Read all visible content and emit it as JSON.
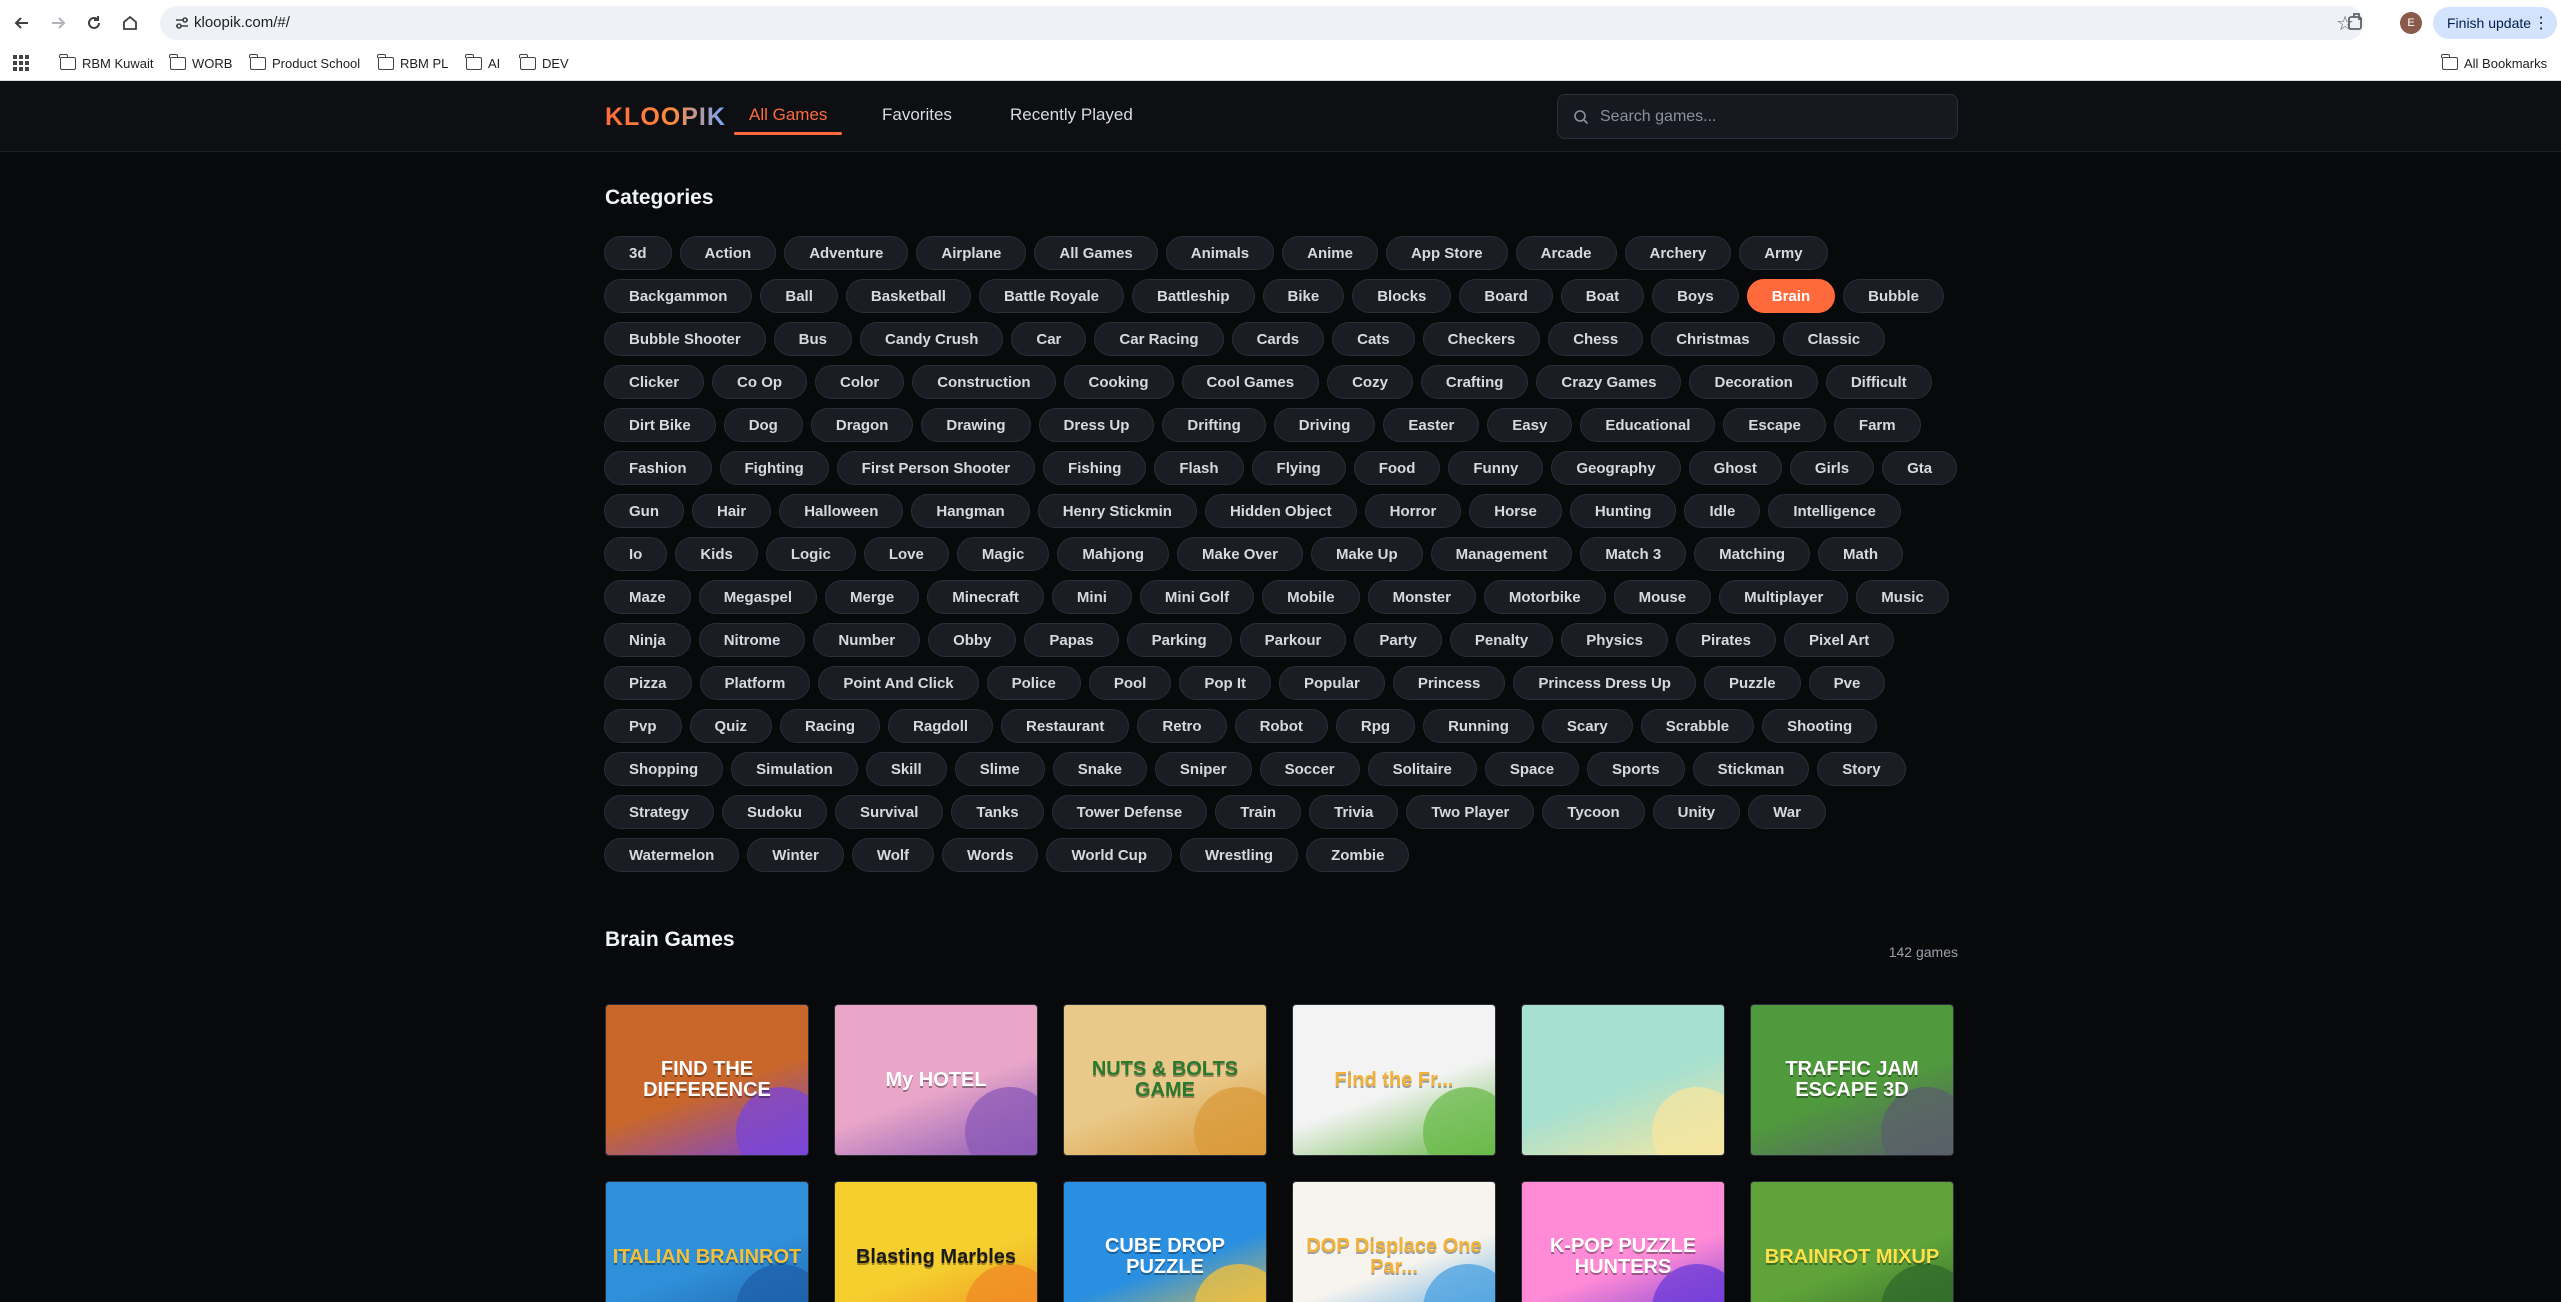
{
  "browser": {
    "url": "kloopik.com/#/",
    "finish_update_label": "Finish update",
    "profile_initial": "E",
    "bookmarks": [
      "RBM Kuwait",
      "WORB",
      "Product School",
      "RBM PL",
      "AI",
      "DEV"
    ],
    "all_bookmarks_label": "All Bookmarks"
  },
  "header": {
    "logo": "KLOOPIK",
    "tabs": [
      "All Games",
      "Favorites",
      "Recently Played"
    ],
    "active_tab": "All Games",
    "search_placeholder": "Search games..."
  },
  "categories": {
    "title": "Categories",
    "active": "Brain",
    "items": [
      "3d",
      "Action",
      "Adventure",
      "Airplane",
      "All Games",
      "Animals",
      "Anime",
      "App Store",
      "Arcade",
      "Archery",
      "Army",
      "Backgammon",
      "Ball",
      "Basketball",
      "Battle Royale",
      "Battleship",
      "Bike",
      "Blocks",
      "Board",
      "Boat",
      "Boys",
      "Brain",
      "Bubble",
      "Bubble Shooter",
      "Bus",
      "Candy Crush",
      "Car",
      "Car Racing",
      "Cards",
      "Cats",
      "Checkers",
      "Chess",
      "Christmas",
      "Classic",
      "Clicker",
      "Co Op",
      "Color",
      "Construction",
      "Cooking",
      "Cool Games",
      "Cozy",
      "Crafting",
      "Crazy Games",
      "Decoration",
      "Difficult",
      "Dirt Bike",
      "Dog",
      "Dragon",
      "Drawing",
      "Dress Up",
      "Drifting",
      "Driving",
      "Easter",
      "Easy",
      "Educational",
      "Escape",
      "Farm",
      "Fashion",
      "Fighting",
      "First Person Shooter",
      "Fishing",
      "Flash",
      "Flying",
      "Food",
      "Funny",
      "Geography",
      "Ghost",
      "Girls",
      "Gta",
      "Gun",
      "Hair",
      "Halloween",
      "Hangman",
      "Henry Stickmin",
      "Hidden Object",
      "Horror",
      "Horse",
      "Hunting",
      "Idle",
      "Intelligence",
      "Io",
      "Kids",
      "Logic",
      "Love",
      "Magic",
      "Mahjong",
      "Make Over",
      "Make Up",
      "Management",
      "Match 3",
      "Matching",
      "Math",
      "Maze",
      "Megaspel",
      "Merge",
      "Minecraft",
      "Mini",
      "Mini Golf",
      "Mobile",
      "Monster",
      "Motorbike",
      "Mouse",
      "Multiplayer",
      "Music",
      "Ninja",
      "Nitrome",
      "Number",
      "Obby",
      "Papas",
      "Parking",
      "Parkour",
      "Party",
      "Penalty",
      "Physics",
      "Pirates",
      "Pixel Art",
      "Pizza",
      "Platform",
      "Point And Click",
      "Police",
      "Pool",
      "Pop It",
      "Popular",
      "Princess",
      "Princess Dress Up",
      "Puzzle",
      "Pve",
      "Pvp",
      "Quiz",
      "Racing",
      "Ragdoll",
      "Restaurant",
      "Retro",
      "Robot",
      "Rpg",
      "Running",
      "Scary",
      "Scrabble",
      "Shooting",
      "Shopping",
      "Simulation",
      "Skill",
      "Slime",
      "Snake",
      "Sniper",
      "Soccer",
      "Solitaire",
      "Space",
      "Sports",
      "Stickman",
      "Story",
      "Strategy",
      "Sudoku",
      "Survival",
      "Tanks",
      "Tower Defense",
      "Train",
      "Trivia",
      "Two Player",
      "Tycoon",
      "Unity",
      "War",
      "Watermelon",
      "Winter",
      "Wolf",
      "Words",
      "World Cup",
      "Wrestling",
      "Zombie"
    ]
  },
  "games_section": {
    "title": "Brain Games",
    "count": "142 games",
    "games": [
      {
        "title": "FIND THE DIFFERENCE",
        "bg": "#c9672a",
        "fg": "#ffffff",
        "bg2": "#7a46d8"
      },
      {
        "title": "My HOTEL",
        "bg": "#e9a6c8",
        "fg": "#ffffff",
        "bg2": "#8b5ab7"
      },
      {
        "title": "NUTS & BOLTS GAME",
        "bg": "#e9c98a",
        "fg": "#2a7a2e",
        "bg2": "#d99a3a"
      },
      {
        "title": "Find the Fr...",
        "bg": "#f3f3f3",
        "fg": "#f2b23a",
        "bg2": "#6ab94a"
      },
      {
        "title": "",
        "bg": "#a8e0cf",
        "fg": "#ffffff",
        "bg2": "#f6e6a0"
      },
      {
        "title": "TRAFFIC JAM ESCAPE 3D",
        "bg": "#4f9a3c",
        "fg": "#ffffff",
        "bg2": "#5a5f6a"
      },
      {
        "title": "ITALIAN BRAINROT",
        "bg": "#2f8fd8",
        "fg": "#f4c03a",
        "bg2": "#1e5fa8"
      },
      {
        "title": "Blasting Marbles",
        "bg": "#f4cf2e",
        "fg": "#1a1a1a",
        "bg2": "#f08a24"
      },
      {
        "title": "CUBE DROP PUZZLE",
        "bg": "#2a8fe0",
        "fg": "#ffffff",
        "bg2": "#f6c23a"
      },
      {
        "title": "DOP Displace One Par...",
        "bg": "#f7f4ee",
        "fg": "#f2b23a",
        "bg2": "#4aa0e0"
      },
      {
        "title": "K-POP PUZZLE HUNTERS",
        "bg": "#ff8ad6",
        "fg": "#ffffff",
        "bg2": "#6a3ad8"
      },
      {
        "title": "BRAINROT MIXUP",
        "bg": "#5fa33a",
        "fg": "#ffe14a",
        "bg2": "#2f6a2a"
      }
    ]
  },
  "colors": {
    "accent": "#ff6a3d",
    "background": "#08090b",
    "chip": "#1a1d24"
  }
}
